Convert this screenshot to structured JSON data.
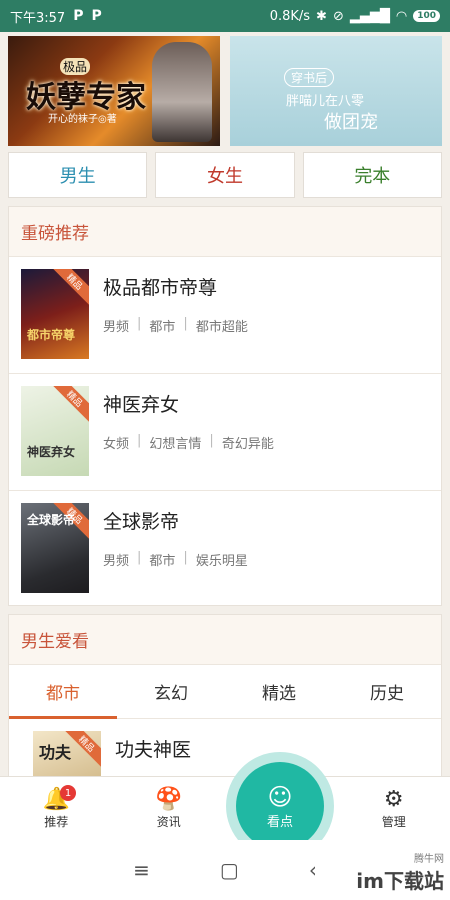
{
  "status_bar": {
    "time": "下午3:57",
    "p1": "P",
    "p2": "P",
    "speed": "0.8K/s",
    "battery": "100"
  },
  "banners": [
    {
      "small": "极品",
      "title": "妖孽专家",
      "author": "开心的袜子◎著"
    },
    {
      "tag": "穿书后",
      "line1": "胖喵儿在八零",
      "line2": "做团宠"
    }
  ],
  "genders": {
    "male": "男生",
    "female": "女生",
    "complete": "完本"
  },
  "featured": {
    "title": "重磅推荐",
    "books": [
      {
        "title": "极品都市帝尊",
        "tags": [
          "男频",
          "都市",
          "都市超能"
        ],
        "cover_text": "都市帝尊",
        "ribbon": "精品"
      },
      {
        "title": "神医弃女",
        "tags": [
          "女频",
          "幻想言情",
          "奇幻异能"
        ],
        "cover_text": "神医弃女",
        "ribbon": "精品"
      },
      {
        "title": "全球影帝",
        "tags": [
          "男频",
          "都市",
          "娱乐明星"
        ],
        "cover_text": "全球影帝",
        "ribbon": "精品"
      }
    ]
  },
  "male_fav": {
    "title": "男生爱看",
    "tabs": [
      "都市",
      "玄幻",
      "精选",
      "历史"
    ],
    "active_tab": 0,
    "books": [
      {
        "title": "功夫神医",
        "cover_text": "功夫",
        "ribbon": "精品"
      }
    ]
  },
  "bottom_nav": {
    "items": [
      {
        "label": "推荐",
        "icon": "bell-icon",
        "badge": "1"
      },
      {
        "label": "资讯",
        "icon": "mushroom-icon"
      },
      {
        "label": "看点",
        "icon": "robot-icon"
      },
      {
        "label": "管理",
        "icon": "gear-icon"
      }
    ]
  },
  "watermark": {
    "text": "im下载站",
    "small": "腾牛网"
  }
}
